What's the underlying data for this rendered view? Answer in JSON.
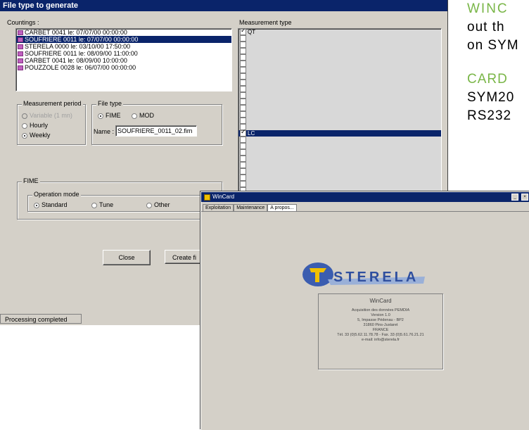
{
  "background_text": {
    "line1": "WINC",
    "line2": "out th",
    "line3": "on SYM",
    "line4": "CARD",
    "line5": "SYM20",
    "line6": "RS232"
  },
  "win1": {
    "title": "File type to generate",
    "countings_label": "Countings :",
    "countings": [
      "CARBET 0041 le: 07/07/00 00:00:00",
      "SOUFRIERE 0011 le: 07/07/00 00:00:00",
      "STERELA 0000 le: 03/10/00 17:50:00",
      "SOUFRIERE 0011 le: 08/09/00 11:00:00",
      "CARBET 0041 le: 08/09/00 10:00:00",
      "POUZZOLE 0028 le: 06/07/00 00:00:00"
    ],
    "measurement_period_label": "Measurement period",
    "period_variable": "Variable (1 mn)",
    "period_hourly": "Hourly",
    "period_weekly": "Weekly",
    "file_type_label": "File type",
    "filetype_fime": "FIME",
    "filetype_mod": "MOD",
    "name_label": "Name :",
    "name_value": "SOUFRIERE_0011_02.fim",
    "fime_label": "FIME",
    "operation_mode_label": "Operation mode",
    "op_standard": "Standard",
    "op_tune": "Tune",
    "op_other": "Other",
    "close_button": "Close",
    "create_button": "Create fi",
    "measurement_type_label": "Measurement type",
    "mt_first": "QT",
    "mt_selected": "LC",
    "status": "Processing completed"
  },
  "win2": {
    "title": "WinCard",
    "tabs": [
      "Exploitation",
      "Maintenance",
      "A propos..."
    ],
    "logo_text": "STERELA",
    "about_title": "WinCard",
    "about_lines": [
      "Acquisition des données PEMDIA",
      "Version 1.0",
      "5, Impasse Pédenau - BP2",
      "31860 Pins-Justaret",
      "FRANCE",
      "Tél. 33 (0)5.62.11.78.78 - Fax. 33 (0)5.61.76.21.21",
      "e-mail: info@sterela.fr"
    ]
  }
}
